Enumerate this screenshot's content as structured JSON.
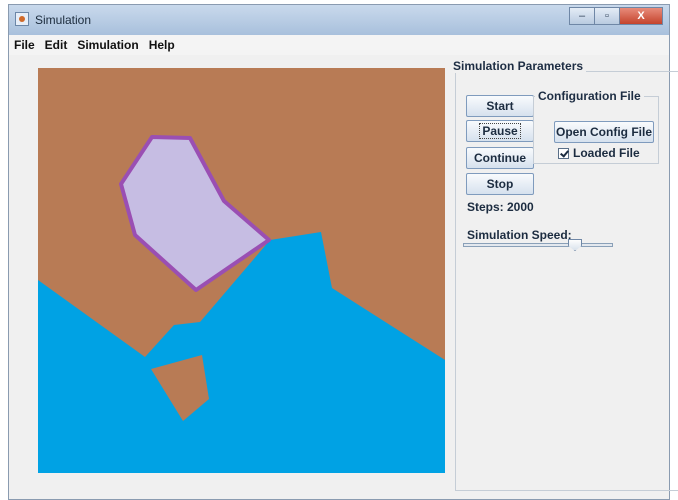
{
  "window": {
    "title": "Simulation",
    "minimize_glyph": "–",
    "maximize_glyph": "▫",
    "close_glyph": "X"
  },
  "menu": {
    "items": [
      "File",
      "Edit",
      "Simulation",
      "Help"
    ]
  },
  "parameters": {
    "legend": "Simulation Parameters",
    "start_label": "Start",
    "pause_label": "Pause",
    "continue_label": "Continue",
    "stop_label": "Stop",
    "steps_label": "Steps: 2000",
    "speed_label": "Simulation Speed:",
    "speed_fraction": 0.75
  },
  "config": {
    "legend": "Configuration File",
    "open_label": "Open Config File",
    "loaded_label": "Loaded File",
    "loaded_checked": true
  },
  "colors": {
    "land": "#b87b55",
    "water": "#00a2e4",
    "polygon_fill": "#c6bde3",
    "polygon_stroke": "#9a4fb3"
  }
}
